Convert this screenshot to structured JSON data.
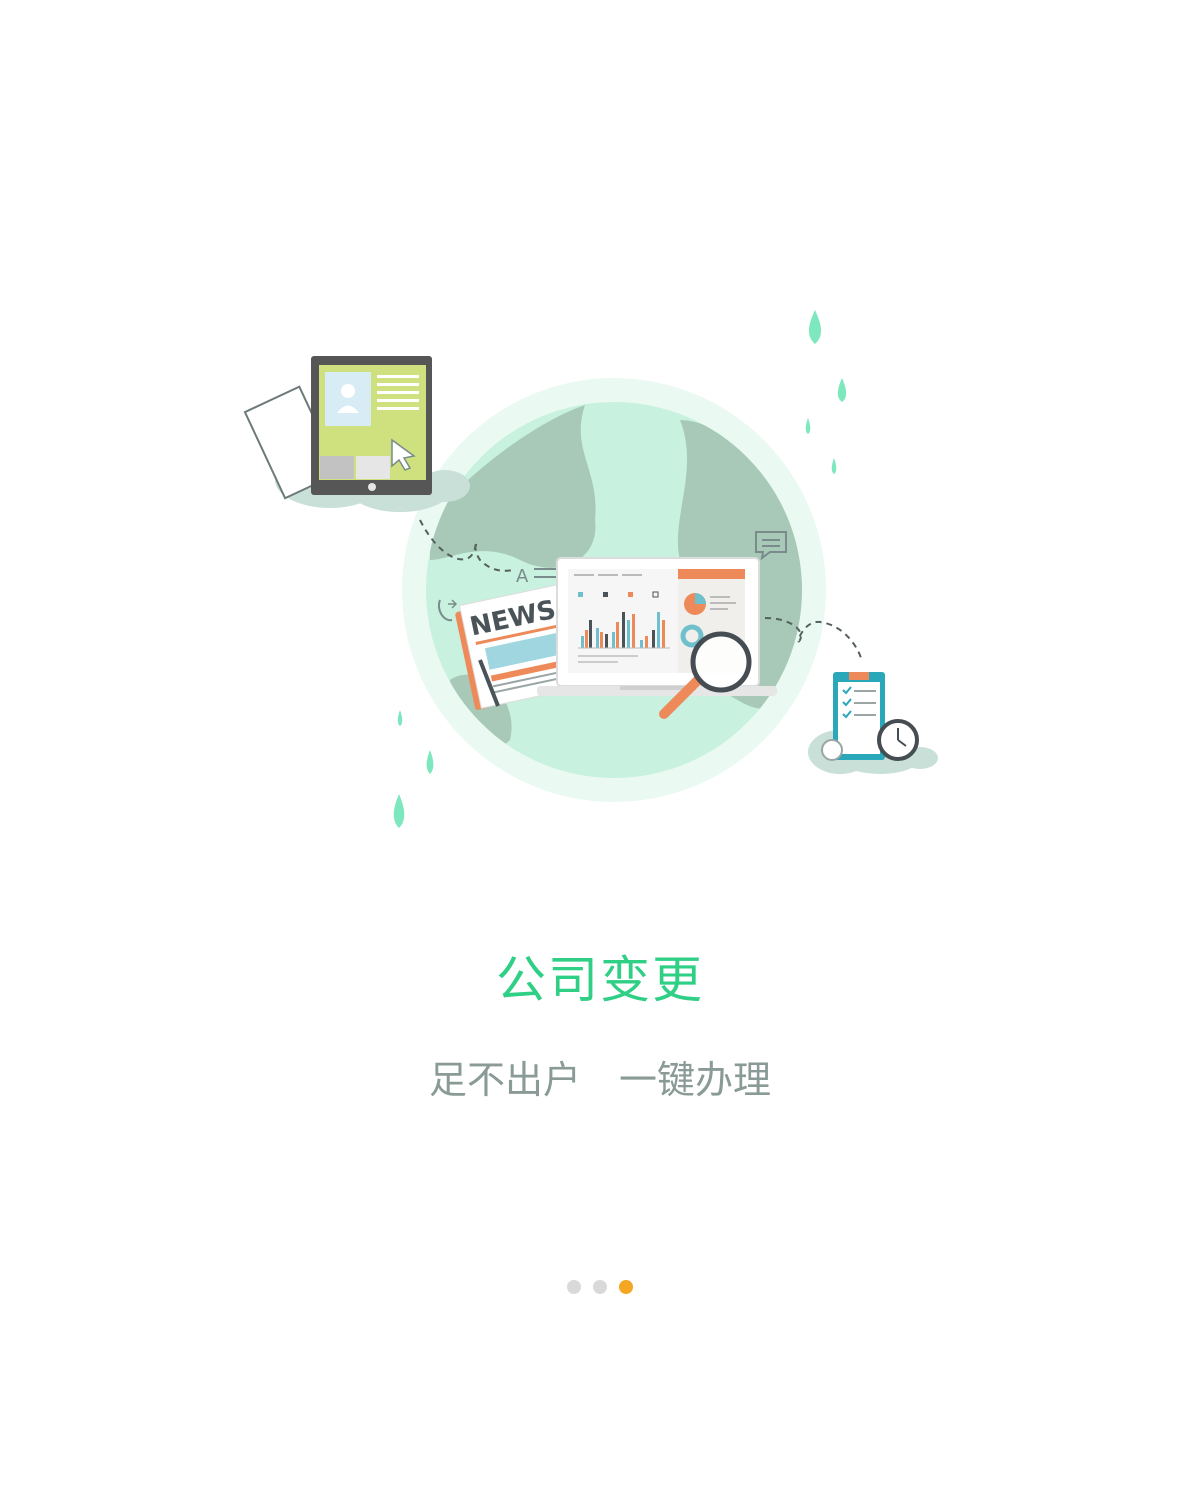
{
  "page": {
    "title": "公司变更",
    "subtitle": "足不出户　一键办理"
  },
  "illustration": {
    "news_label": "NEWS",
    "icons": [
      "globe-icon",
      "tablet-icon",
      "laptop-chart-icon",
      "newspaper-icon",
      "magnifier-icon",
      "clipboard-icon",
      "clock-icon",
      "chat-bubble-icon",
      "phone-icon",
      "coin-icon"
    ]
  },
  "pager": {
    "count": 3,
    "active_index": 2,
    "active_color": "#f5a623",
    "inactive_color": "#d9d9d9"
  },
  "colors": {
    "title": "#2fcf86",
    "subtitle": "#8a9a96",
    "drop": "#7de8bd"
  }
}
